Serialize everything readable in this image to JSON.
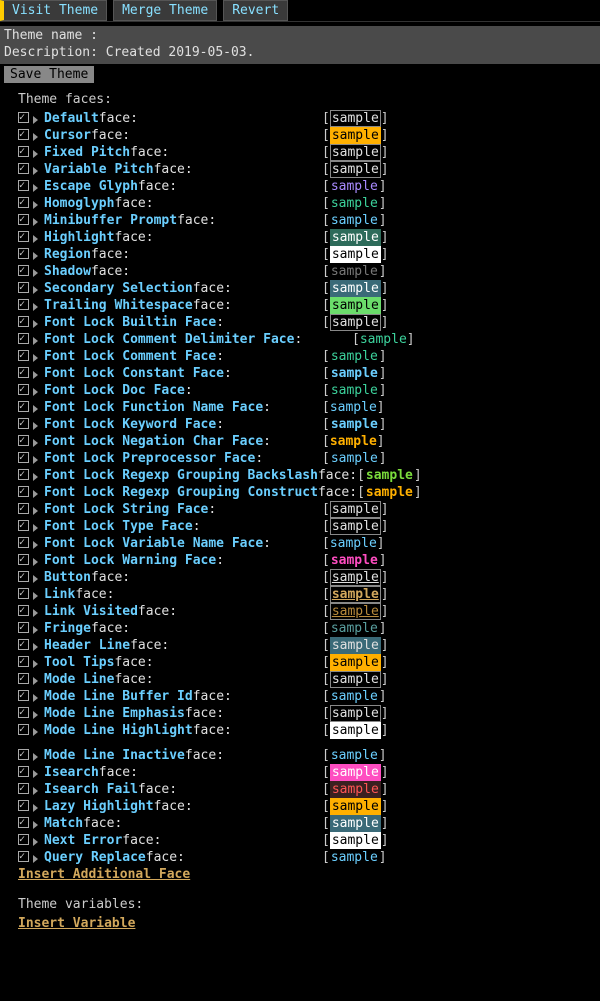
{
  "toolbar": {
    "visit": "Visit Theme",
    "merge": "Merge Theme",
    "revert": "Revert"
  },
  "props": {
    "name_label": "Theme name : ",
    "name_value": "",
    "desc_label": "Description: ",
    "desc_value": "Created 2019-05-03."
  },
  "save_label": "Save Theme",
  "section_faces": "Theme faces:",
  "section_vars": "Theme variables:",
  "insert_face": "Insert Additional Face",
  "insert_var": "Insert Variable",
  "sample_text": "sample",
  "face_word": " face:",
  "faces": [
    {
      "name": "Default",
      "suffix": " face:",
      "sfg": "#e0e0e0",
      "sbg": "",
      "sb": true,
      "col": 304
    },
    {
      "name": "Cursor",
      "suffix": " face:",
      "sfg": "#000",
      "sbg": "#ffb000",
      "sb": true,
      "col": 304
    },
    {
      "name": "Fixed Pitch",
      "suffix": " face:",
      "sfg": "#e0e0e0",
      "sbg": "",
      "sb": true,
      "col": 304
    },
    {
      "name": "Variable Pitch",
      "suffix": " face:",
      "sfg": "#e0e0e0",
      "sbg": "",
      "sb": true,
      "col": 304
    },
    {
      "name": "Escape Glyph",
      "suffix": " face:",
      "sfg": "#a98bff",
      "sbg": "",
      "sb": false,
      "col": 304
    },
    {
      "name": "Homoglyph",
      "suffix": " face:",
      "sfg": "#3cd29c",
      "sbg": "",
      "sb": false,
      "col": 304
    },
    {
      "name": "Minibuffer Prompt",
      "suffix": " face:",
      "sfg": "#6bcfff",
      "sbg": "",
      "sb": false,
      "col": 304
    },
    {
      "name": "Highlight",
      "suffix": " face:",
      "sfg": "#fff",
      "sbg": "#2d6b5a",
      "sb": true,
      "col": 304
    },
    {
      "name": "Region",
      "suffix": " face:",
      "sfg": "#000",
      "sbg": "#fff",
      "sb": true,
      "col": 304
    },
    {
      "name": "Shadow",
      "suffix": " face:",
      "sfg": "#777",
      "sbg": "",
      "sb": false,
      "col": 304
    },
    {
      "name": "Secondary Selection",
      "suffix": " face:",
      "sfg": "#fff",
      "sbg": "#3a6a78",
      "sb": true,
      "col": 304
    },
    {
      "name": "Trailing Whitespace",
      "suffix": " face:",
      "sfg": "#000",
      "sbg": "#6bdc6b",
      "sb": true,
      "col": 304
    },
    {
      "name": "Font Lock Builtin Face",
      "suffix": ":",
      "sfg": "#e0e0e0",
      "sbg": "",
      "sb": true,
      "col": 304
    },
    {
      "name": "Font Lock Comment Delimiter Face",
      "suffix": ":",
      "sfg": "#3cd29c",
      "sbg": "",
      "sb": false,
      "col": 334,
      "tight": true
    },
    {
      "name": "Font Lock Comment Face",
      "suffix": ":",
      "sfg": "#3cd29c",
      "sbg": "",
      "sb": false,
      "col": 304
    },
    {
      "name": "Font Lock Constant Face",
      "suffix": ":",
      "sfg": "#6bcfff",
      "sbg": "",
      "sb": false,
      "bold": true,
      "col": 304
    },
    {
      "name": "Font Lock Doc Face",
      "suffix": ":",
      "sfg": "#3cd29c",
      "sbg": "",
      "sb": false,
      "col": 304
    },
    {
      "name": "Font Lock Function Name Face",
      "suffix": ":",
      "sfg": "#6bcfff",
      "sbg": "",
      "sb": false,
      "col": 304,
      "tight": true
    },
    {
      "name": "Font Lock Keyword Face",
      "suffix": ":",
      "sfg": "#6bcfff",
      "sbg": "",
      "sb": false,
      "bold": true,
      "col": 304
    },
    {
      "name": "Font Lock Negation Char Face",
      "suffix": ":",
      "sfg": "#ffb000",
      "sbg": "",
      "sb": false,
      "bold": true,
      "col": 304,
      "tight": true
    },
    {
      "name": "Font Lock Preprocessor Face",
      "suffix": ":",
      "sfg": "#6bcfff",
      "sbg": "",
      "sb": false,
      "col": 304
    },
    {
      "name": "Font Lock Regexp Grouping Backslash",
      "suffix": " face: ",
      "sfg": "#7bdc3c",
      "sbg": "",
      "sb": false,
      "bold": true,
      "inline": true
    },
    {
      "name": "Font Lock Regexp Grouping Construct",
      "suffix": " face: ",
      "sfg": "#ffb000",
      "sbg": "",
      "sb": false,
      "bold": true,
      "inline": true
    },
    {
      "name": "Font Lock String Face",
      "suffix": ":",
      "sfg": "#e0e0e0",
      "sbg": "",
      "sb": true,
      "col": 304
    },
    {
      "name": "Font Lock Type Face",
      "suffix": ":",
      "sfg": "#e0e0e0",
      "sbg": "",
      "sb": true,
      "col": 304
    },
    {
      "name": "Font Lock Variable Name Face",
      "suffix": ":",
      "sfg": "#6bcfff",
      "sbg": "",
      "sb": false,
      "col": 304,
      "tight": true
    },
    {
      "name": "Font Lock Warning Face",
      "suffix": ":",
      "sfg": "#ff4dc1",
      "sbg": "",
      "sb": false,
      "bold": true,
      "col": 304
    },
    {
      "name": "Button",
      "suffix": " face:",
      "sfg": "#e0e0e0",
      "sbg": "",
      "sb": true,
      "ul": true,
      "col": 304
    },
    {
      "name": "Link",
      "suffix": " face:",
      "sfg": "#d2a85c",
      "sbg": "",
      "sb": true,
      "ul": true,
      "bold": true,
      "col": 304
    },
    {
      "name": "Link Visited",
      "suffix": " face:",
      "sfg": "#b88a3c",
      "sbg": "",
      "sb": true,
      "ul": true,
      "col": 304
    },
    {
      "name": "Fringe",
      "suffix": " face:",
      "sfg": "#5aa0a0",
      "sbg": "",
      "sb": false,
      "col": 304
    },
    {
      "name": "Header Line",
      "suffix": " face:",
      "sfg": "#e0e0e0",
      "sbg": "#3a6a78",
      "sb": true,
      "col": 304
    },
    {
      "name": "Tool Tips",
      "suffix": " face:",
      "sfg": "#000",
      "sbg": "#ffb000",
      "sb": true,
      "col": 304
    },
    {
      "name": "Mode Line",
      "suffix": " face:",
      "sfg": "#e0e0e0",
      "sbg": "",
      "sb": true,
      "col": 304
    },
    {
      "name": "Mode Line Buffer Id",
      "suffix": " face:",
      "sfg": "#6bcfff",
      "sbg": "",
      "sb": false,
      "col": 304
    },
    {
      "name": "Mode Line Emphasis",
      "suffix": " face:",
      "sfg": "#e0e0e0",
      "sbg": "",
      "sb": true,
      "col": 304
    },
    {
      "name": "Mode Line Highlight",
      "suffix": " face:",
      "sfg": "#000",
      "sbg": "#fff",
      "sb": true,
      "col": 304
    },
    {
      "spacer": true
    },
    {
      "name": "Mode Line Inactive",
      "suffix": " face:",
      "sfg": "#6bcfff",
      "sbg": "",
      "sb": false,
      "col": 304
    },
    {
      "name": "Isearch",
      "suffix": " face:",
      "sfg": "#fff",
      "sbg": "#ff4dc1",
      "sb": true,
      "col": 304
    },
    {
      "name": "Isearch Fail",
      "suffix": " face:",
      "sfg": "#ff5555",
      "sbg": "#3a2020",
      "sb": true,
      "col": 304
    },
    {
      "name": "Lazy Highlight",
      "suffix": " face:",
      "sfg": "#000",
      "sbg": "#ffb000",
      "sb": true,
      "col": 304
    },
    {
      "name": "Match",
      "suffix": " face:",
      "sfg": "#fff",
      "sbg": "#3a6a78",
      "sb": true,
      "col": 304
    },
    {
      "name": "Next Error",
      "suffix": " face:",
      "sfg": "#000",
      "sbg": "#fff",
      "sb": true,
      "col": 304
    },
    {
      "name": "Query Replace",
      "suffix": " face:",
      "sfg": "#6bcfff",
      "sbg": "",
      "sb": false,
      "col": 304
    }
  ]
}
